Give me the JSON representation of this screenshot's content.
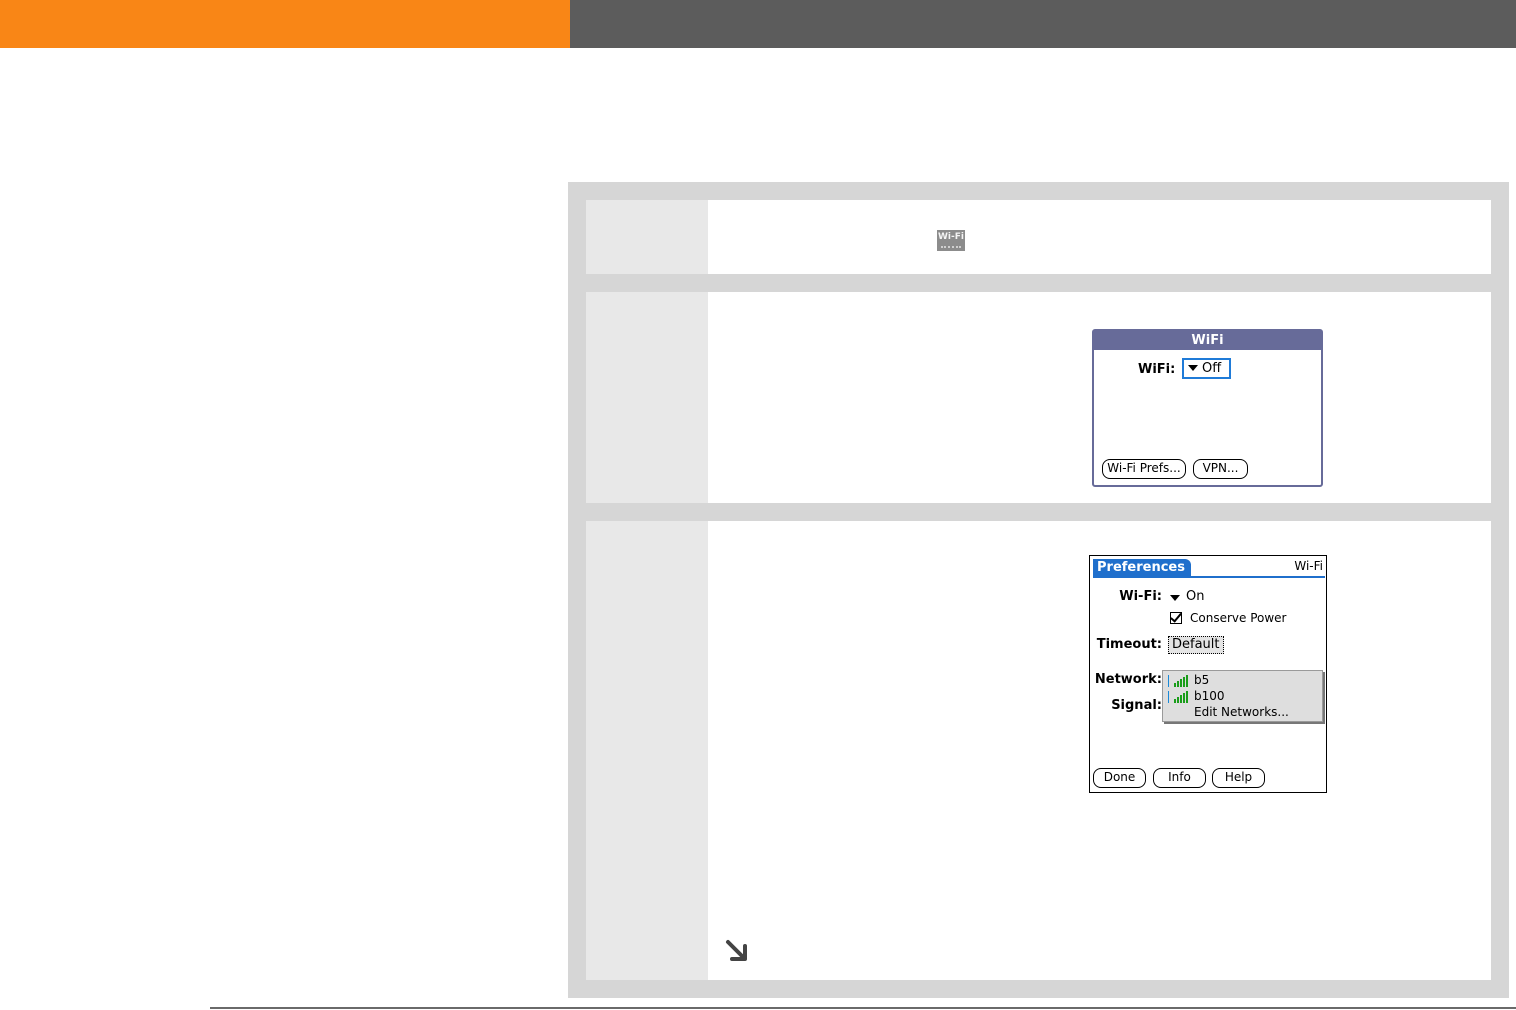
{
  "wifi_dialog": {
    "title": "WiFi",
    "label": "WiFi:",
    "value": "Off",
    "buttons": [
      "Wi-Fi Prefs...",
      "VPN..."
    ]
  },
  "inline_icon": {
    "text": "Wi-Fi"
  },
  "prefs_screen": {
    "tab": "Preferences",
    "corner": "Wi-Fi",
    "wifi_label": "Wi-Fi:",
    "wifi_value": "On",
    "conserve_power": "Conserve Power",
    "timeout_label": "Timeout:",
    "timeout_value": "Default",
    "network_label": "Network:",
    "signal_label": "Signal:",
    "networks": [
      "b5",
      "b100",
      "Edit Networks..."
    ],
    "buttons": [
      "Done",
      "Info",
      "Help"
    ]
  },
  "colors": {
    "orange": "#f98616",
    "header_gray": "#5c5c5c",
    "palm_title": "#676b99",
    "palm_blue": "#1f6fcc"
  }
}
